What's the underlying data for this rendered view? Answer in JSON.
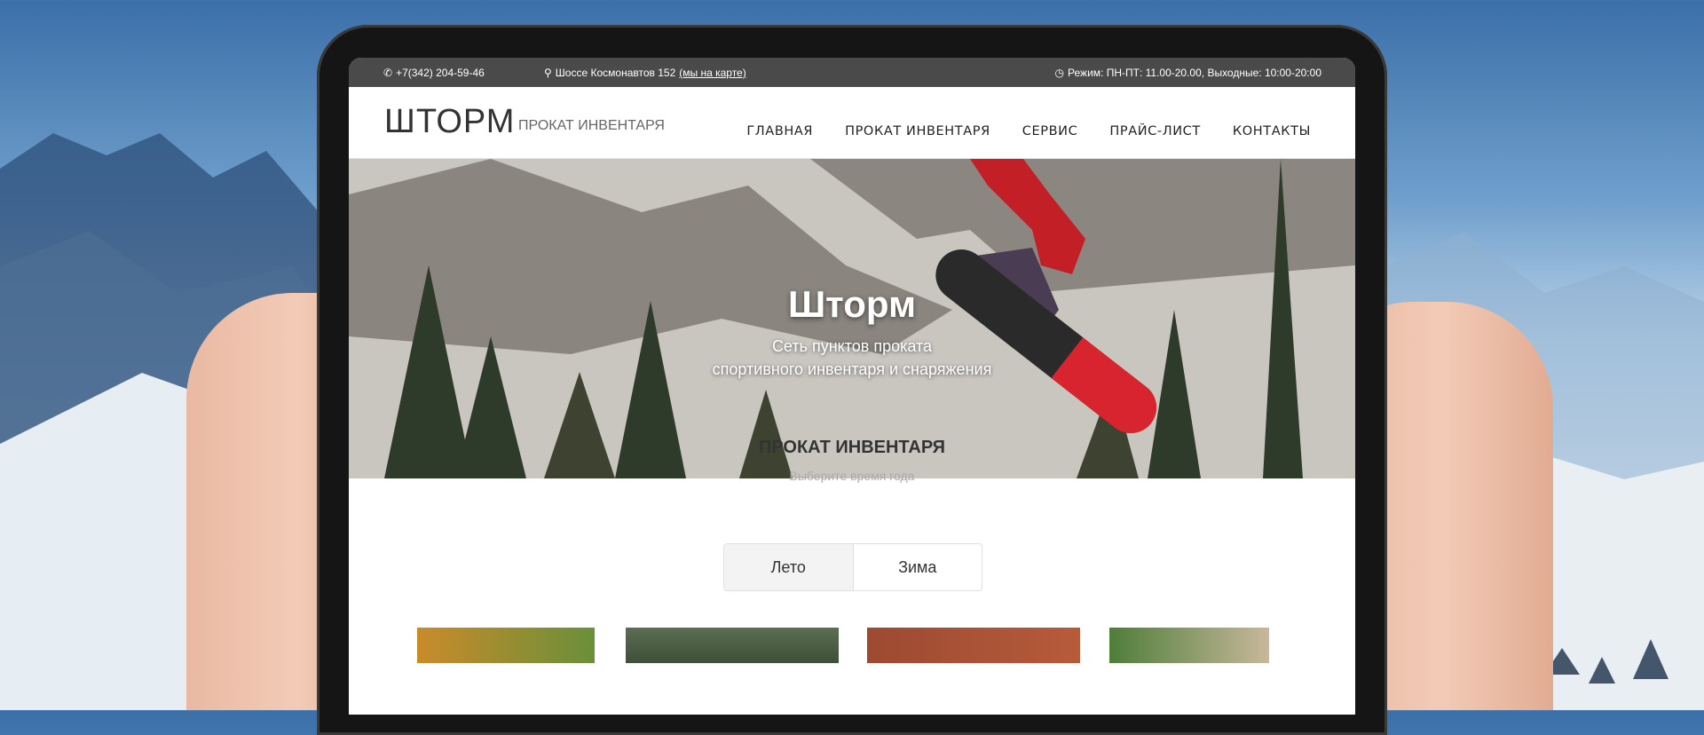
{
  "topbar": {
    "phone": "+7(342) 204-59-46",
    "address": "Шоссе Космонавтов 152",
    "map_link": "(мы на карте)",
    "hours": "Режим: ПН-ПТ: 11.00-20.00, Выходные: 10:00-20:00"
  },
  "header": {
    "logo": "ШТОРМ",
    "tagline": "ПРОКАТ ИНВЕНТАРЯ",
    "nav": [
      "ГЛАВНАЯ",
      "ПРОКАТ ИНВЕНТАРЯ",
      "СЕРВИС",
      "ПРАЙС-ЛИСТ",
      "КОНТАКТЫ"
    ]
  },
  "hero": {
    "title": "Шторм",
    "subtitle_line1": "Сеть пунктов проката",
    "subtitle_line2": "спортивного инвентаря и снаряжения"
  },
  "rental": {
    "title": "ПРОКАТ ИНВЕНТАРЯ",
    "subtitle": "Выберите время года",
    "season_summer": "Лето",
    "season_winter": "Зима",
    "selected": "Лето"
  },
  "colors": {
    "topbar": "#4a4a4a",
    "accent_red": "#d7242f"
  }
}
